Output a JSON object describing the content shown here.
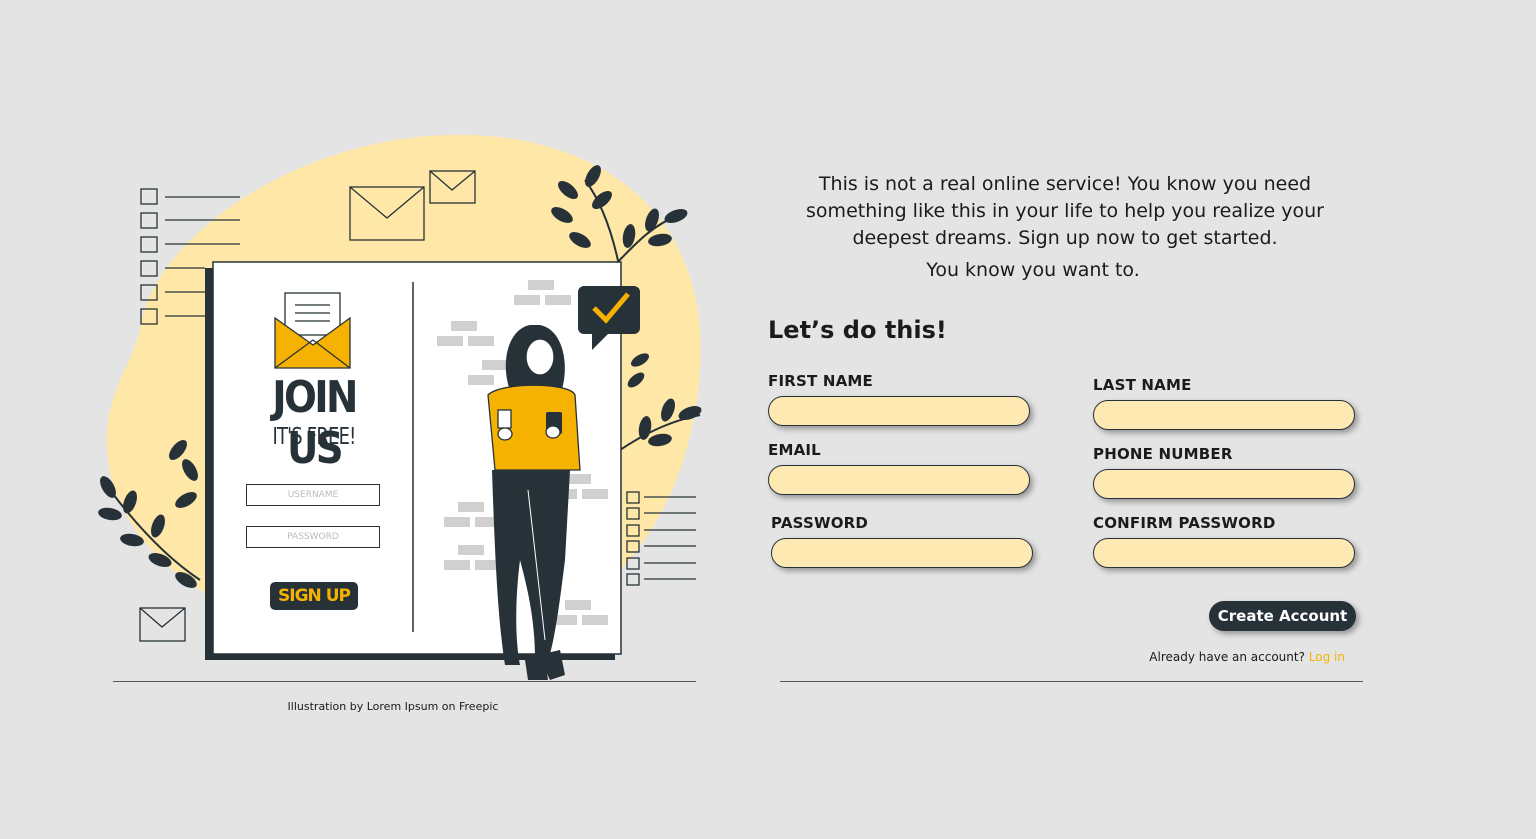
{
  "illustration": {
    "poster_title": "JOIN US",
    "poster_subtitle": "IT'S FREE!",
    "poster_username_placeholder": "USERNAME",
    "poster_password_placeholder": "PASSWORD",
    "poster_button": "SIGN UP",
    "credit": "Illustration by Lorem Ipsum on Freepic"
  },
  "intro": {
    "text": "This is not a real online service! You know you need something like this in your life to help you realize your deepest dreams. Sign up now to get started.",
    "text_2": "You know you want to."
  },
  "form": {
    "heading": "Let’s do this!",
    "fields": {
      "first_name": {
        "label": "FIRST NAME",
        "value": ""
      },
      "last_name": {
        "label": "LAST NAME",
        "value": ""
      },
      "email": {
        "label": "EMAIL",
        "value": ""
      },
      "phone": {
        "label": "PHONE NUMBER",
        "value": ""
      },
      "password": {
        "label": "PASSWORD",
        "value": ""
      },
      "confirm_password": {
        "label": "CONFIRM PASSWORD",
        "value": ""
      }
    },
    "submit_label": "Create Account",
    "login_prompt": "Already have an account?",
    "login_link": "Log in"
  },
  "colors": {
    "background": "#e4e4e4",
    "accent_yellow": "#f5b201",
    "input_fill": "#ffe9b2",
    "dark": "#263238",
    "blob": "#ffe7a8"
  }
}
